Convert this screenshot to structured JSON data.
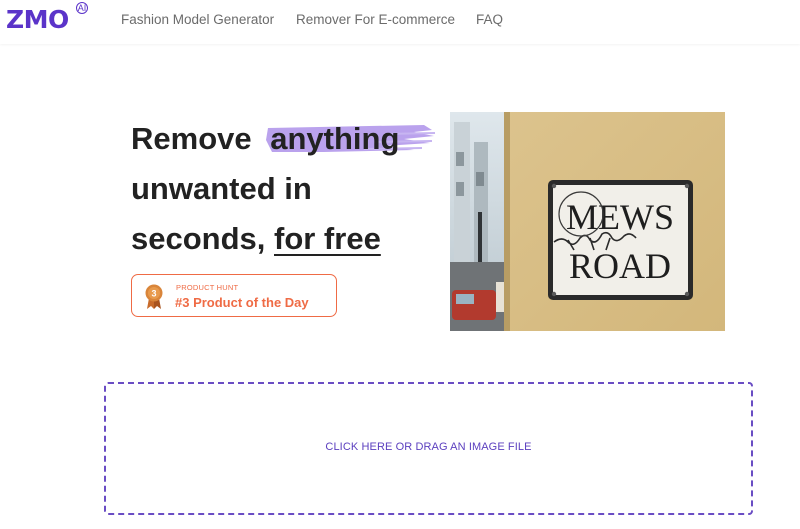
{
  "brand": {
    "name": "ZMO",
    "badge": "AI",
    "color": "#5b34c9"
  },
  "nav": {
    "items": [
      {
        "label": "Fashion Model Generator"
      },
      {
        "label": "Remover For E-commerce"
      },
      {
        "label": "FAQ"
      }
    ]
  },
  "hero": {
    "line1_start": "Remove",
    "line1_highlight": "anything",
    "line2": "unwanted in",
    "line3_start": "seconds, ",
    "line3_underlined": "for free",
    "highlight_color": "#a98be8"
  },
  "badge": {
    "eyebrow": "PRODUCT HUNT",
    "title": "#3 Product of the Day",
    "medal_rank": "3",
    "color": "#ef6b45"
  },
  "example_image": {
    "sign_line1": "MEWS",
    "sign_line2": "ROAD"
  },
  "dropzone": {
    "label": "CLICK HERE OR DRAG AN IMAGE FILE",
    "border_color": "#6a4dc4"
  }
}
